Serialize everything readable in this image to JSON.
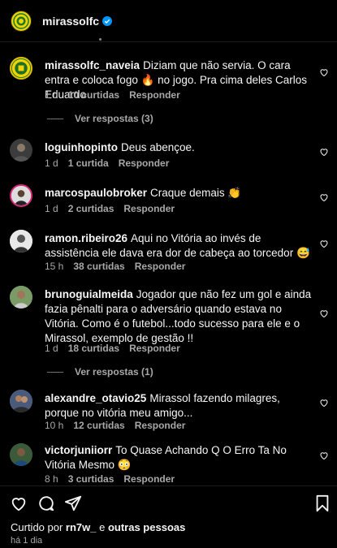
{
  "header": {
    "username": "mirassolfc"
  },
  "comments": [
    {
      "author": "mirassolfc_naveia",
      "text": "Diziam que não servia. O cara entra e coloca fogo 🔥 no jogo. Pra cima deles Carlos Eduardo",
      "time": "1 d",
      "likes": "10 curtidas",
      "reply": "Responder",
      "view_replies": "Ver respostas (3)"
    },
    {
      "author": "loguinhopinto",
      "text": "Deus abençoe.",
      "time": "1 d",
      "likes": "1 curtida",
      "reply": "Responder"
    },
    {
      "author": "marcospaulobroker",
      "text": "Craque demais 👏",
      "time": "1 d",
      "likes": "2 curtidas",
      "reply": "Responder"
    },
    {
      "author": "ramon.ribeiro26",
      "text": "Aqui no Vitória ao invés de assistência ele dava era dor de cabeça ao torcedor 😅",
      "time": "15 h",
      "likes": "38 curtidas",
      "reply": "Responder"
    },
    {
      "author": "brunoguialmeida",
      "text": "Jogador que não fez um gol e ainda fazia pênalti para o adversário quando estava no Vitória. Como é o futebol...todo sucesso para ele e o Mirassol, exemplo de gestão !!",
      "time": "1 d",
      "likes": "18 curtidas",
      "reply": "Responder",
      "view_replies": "Ver respostas (1)"
    },
    {
      "author": "alexandre_otavio25",
      "text": "Mirassol fazendo milagres, porque no vitória meu amigo...",
      "time": "10 h",
      "likes": "12 curtidas",
      "reply": "Responder"
    },
    {
      "author": "victorjuniiorr",
      "text": "To Quase Achando Q O Erro Ta No Vitória Mesmo 😳",
      "time": "8 h",
      "likes": "3 curtidas",
      "reply": "Responder"
    }
  ],
  "footer": {
    "liked_prefix": "Curtido por ",
    "liked_user": "rn7w_",
    "liked_mid": " e ",
    "liked_others": "outras pessoas",
    "time_ago": "há 1 dia"
  },
  "colors": {
    "background": "#000000",
    "text": "#f5f5f5",
    "muted": "#a8a8a8",
    "verified": "#0095f6",
    "brand_yellow": "#f1d400"
  },
  "icons": {
    "verified": "verified-badge-icon",
    "like": "heart-icon",
    "comment": "comment-icon",
    "share": "share-icon",
    "save": "bookmark-icon"
  }
}
